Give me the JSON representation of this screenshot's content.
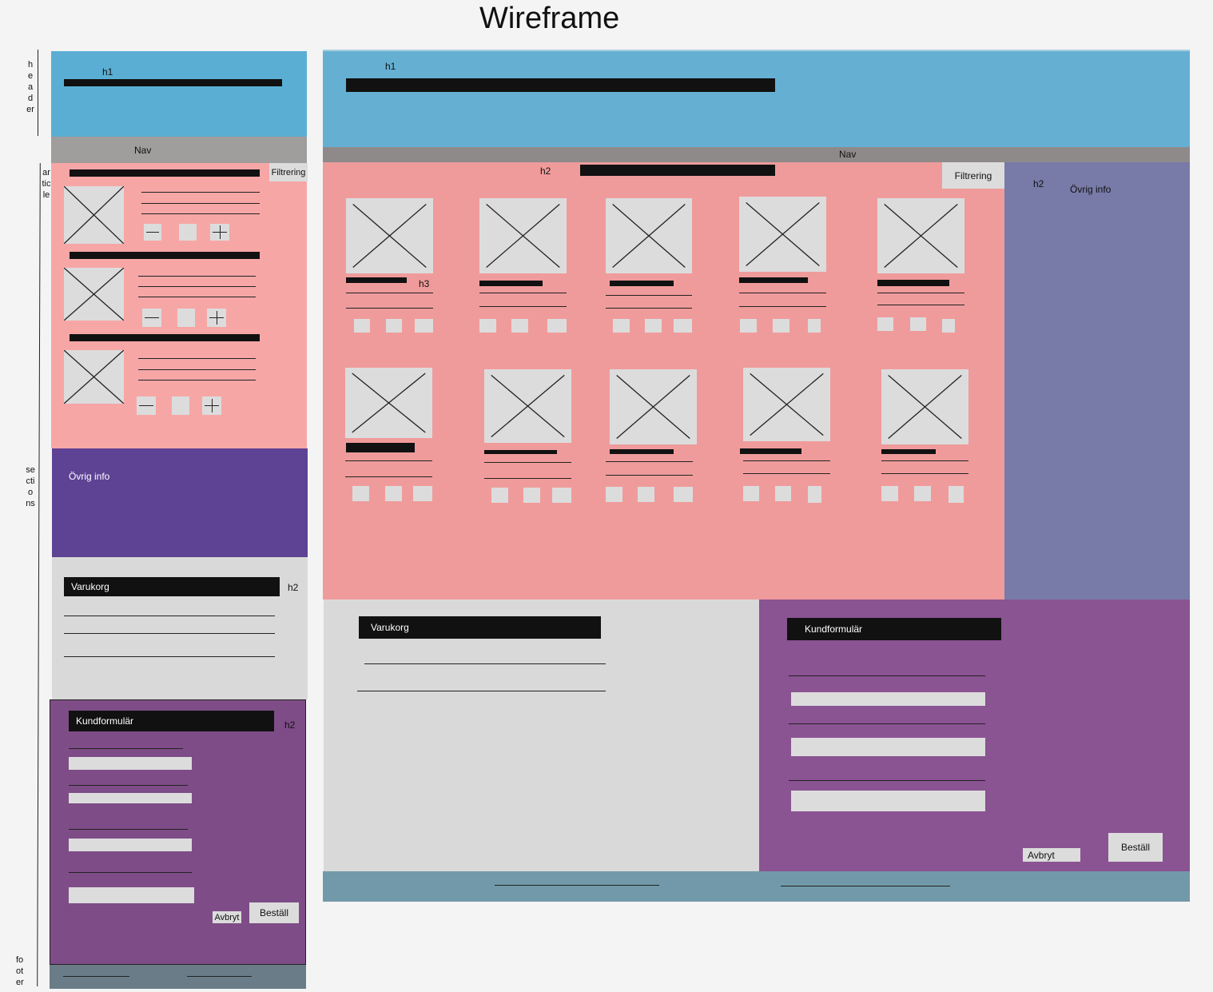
{
  "title": "Wireframe",
  "colors": {
    "header": "#5aaed3",
    "nav": "#a09d9d",
    "section": "#f7a6a6",
    "ovrig_mobile": "#5e4294",
    "ovrig_desktop": "#787ba8",
    "varukorg": "#d9d9d9",
    "kundformular": "#7e4c87",
    "footer": "#6a7c88"
  },
  "side_labels": {
    "header": "header",
    "article": "article",
    "sections": "sections",
    "footer": [
      "fo",
      "ot",
      "er"
    ]
  },
  "mobile": {
    "h1": "h1",
    "nav": "Nav",
    "filter": "Filtrering",
    "ovrig_info": "Övrig info",
    "varukorg": "Varukorg",
    "varukorg_h2": "h2",
    "kundformular": "Kundformulär",
    "kundformular_h2": "h2",
    "cancel": "Avbryt",
    "order": "Beställ"
  },
  "desktop": {
    "h1": "h1",
    "nav": "Nav",
    "h2": "h2",
    "filter": "Filtrering",
    "aside_h2": "h2",
    "ovrig_info": "Övrig info",
    "h3": "h3",
    "varukorg": "Varukorg",
    "kundformular": "Kundformulär",
    "cancel": "Avbryt",
    "order": "Beställ"
  }
}
